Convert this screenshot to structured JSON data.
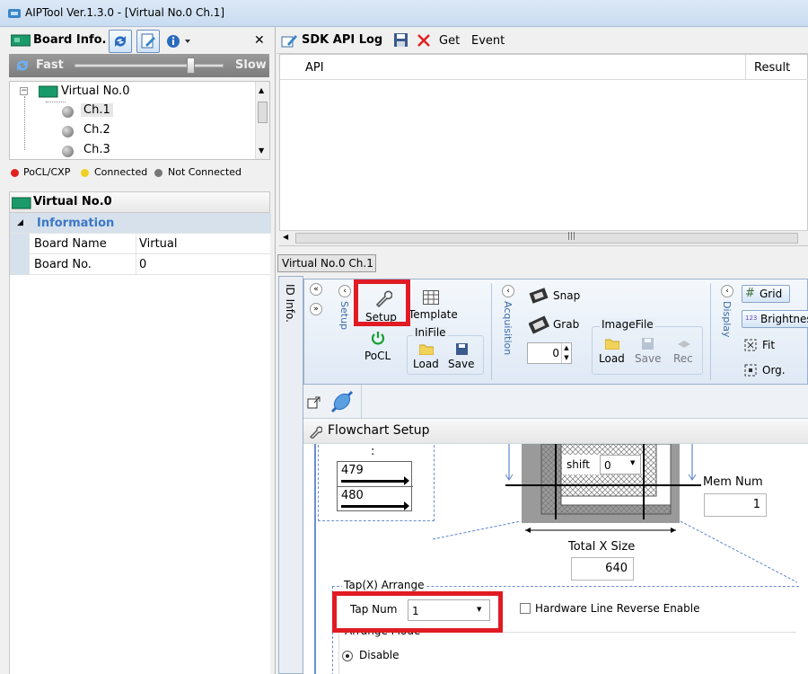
{
  "window": {
    "title": "AIPTool Ver.1.3.0 - [Virtual No.0 Ch.1]"
  },
  "board_panel": {
    "title": "Board Info.",
    "speed_fast": "Fast",
    "speed_slow": "Slow",
    "speed_level": 0.78,
    "tree": {
      "root": "Virtual No.0",
      "channels": [
        "Ch.1",
        "Ch.2",
        "Ch.3"
      ]
    },
    "legend": [
      {
        "label": "PoCL/CXP",
        "color": "#e02020"
      },
      {
        "label": "Connected",
        "color": "#f0d020"
      },
      {
        "label": "Not Connected",
        "color": "#777777"
      }
    ]
  },
  "virtual_panel": {
    "title": "Virtual No.0",
    "category": "Information",
    "rows": [
      {
        "name": "Board Name",
        "value": "Virtual"
      },
      {
        "name": "Board No.",
        "value": "0"
      }
    ]
  },
  "sdk_panel": {
    "title": "SDK API Log",
    "get_label": "Get",
    "event_label": "Event",
    "columns": [
      "API",
      "Result"
    ]
  },
  "doc_tab": "Virtual No.0 Ch.1",
  "side_tab": "ID Info.",
  "ribbon": {
    "setup_group": "Setup",
    "setup_button": "Setup",
    "template_button": "Template",
    "pocl_button": "PoCL",
    "inifile_label": "IniFile",
    "inifile_load": "Load",
    "inifile_save": "Save",
    "acq_group": "Acquisition",
    "snap_button": "Snap",
    "grab_button": "Grab",
    "grab_count": "0",
    "imagefile_label": "ImageFile",
    "image_load": "Load",
    "image_save": "Save",
    "image_rec": "Rec",
    "display_group": "Display",
    "grid_button": "Grid",
    "brightness_button": "Brightness",
    "fit_button": "Fit",
    "org_button": "Org."
  },
  "flowchart": {
    "title": "Flowchart Setup",
    "colon": ":",
    "line_479": "479",
    "line_480": "480",
    "shift_label": "shift",
    "shift_value": "0",
    "mem_num_label": "Mem Num",
    "mem_num_value": "1",
    "total_x_label": "Total X Size",
    "total_x_value": "640",
    "tap_group": "Tap(X) Arrange",
    "tap_num_label": "Tap Num",
    "tap_num_value": "1",
    "hw_reverse_label": "Hardware Line Reverse Enable",
    "arrange_mode_label": "Arrange Mode",
    "disable_label": "Disable"
  }
}
